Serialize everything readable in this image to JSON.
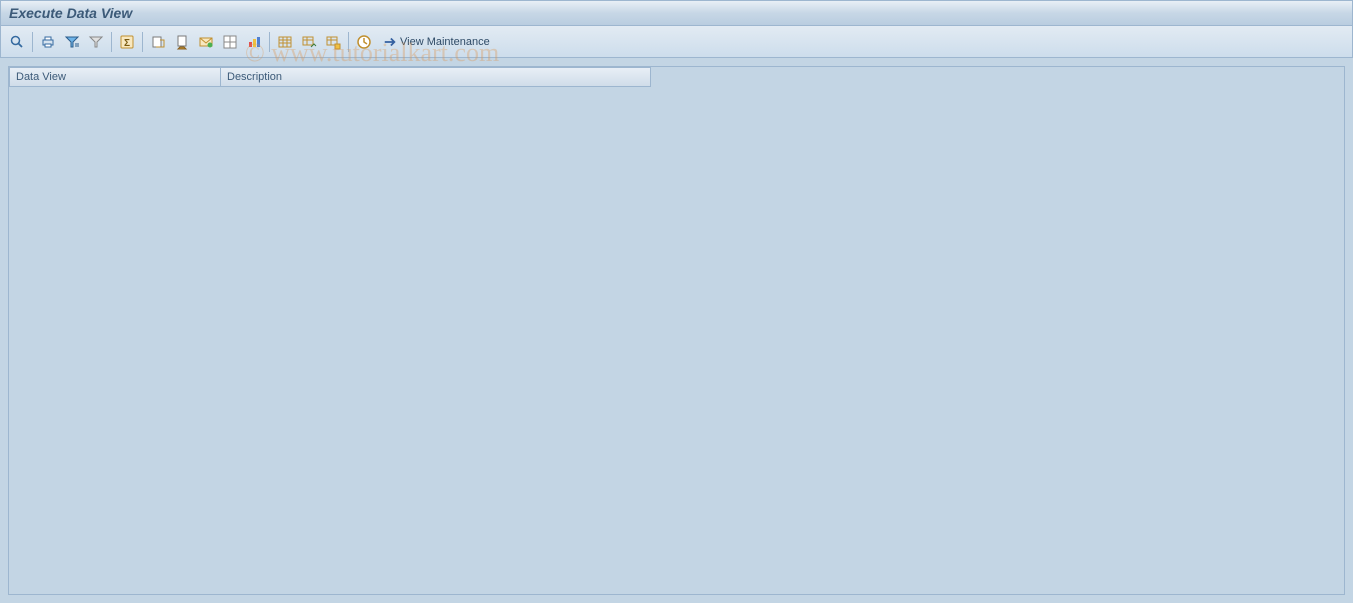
{
  "header": {
    "title": "Execute Data View"
  },
  "toolbar": {
    "view_maintenance_label": "View Maintenance"
  },
  "grid": {
    "columns": [
      {
        "label": "Data View"
      },
      {
        "label": "Description"
      }
    ]
  },
  "watermark": "© www.tutorialkart.com"
}
